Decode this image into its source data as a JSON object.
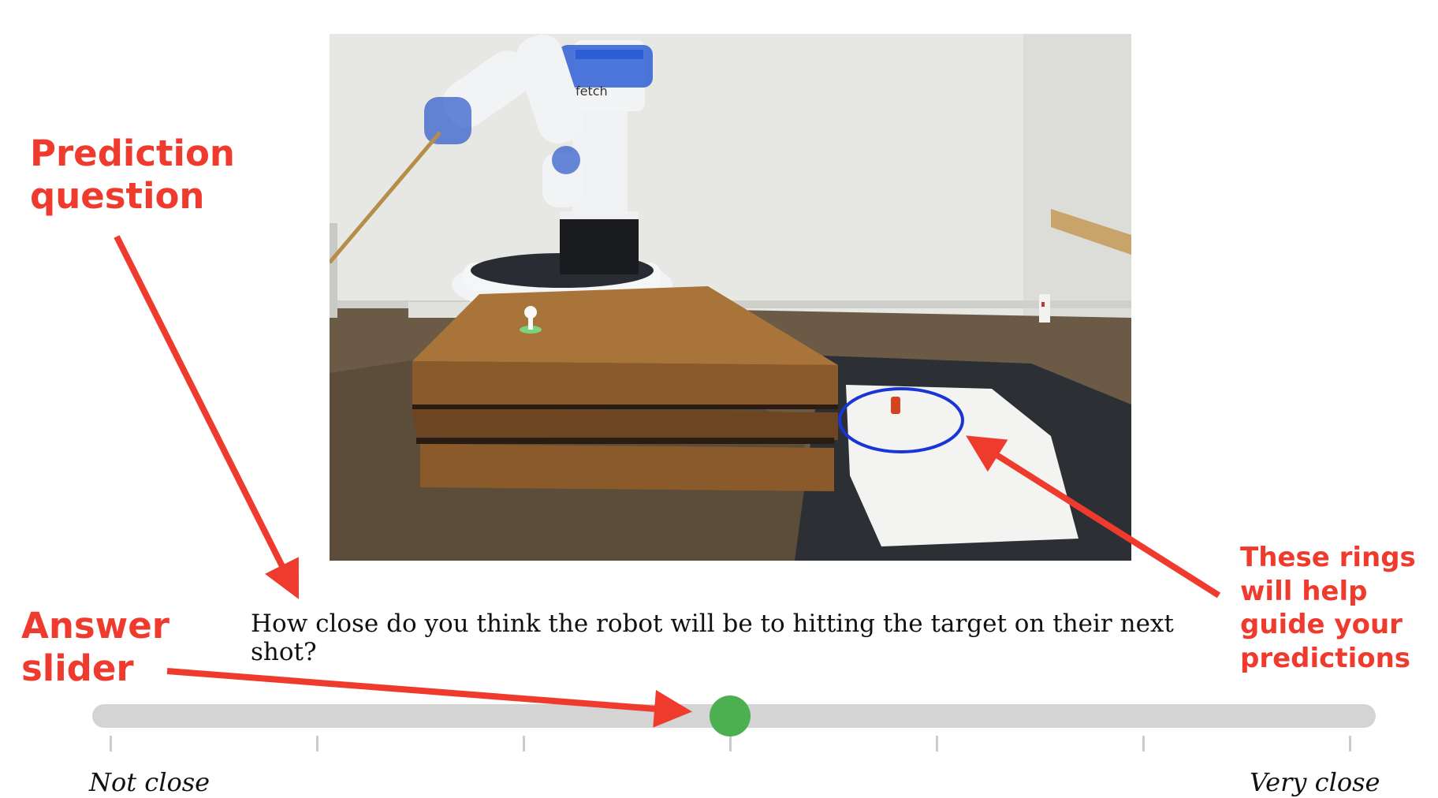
{
  "annotations": {
    "prediction_question": "Prediction\nquestion",
    "answer_slider": "Answer\nslider",
    "rings_hint": "These rings\nwill help\nguide your\npredictions"
  },
  "question": {
    "text": "How close do you think the robot will be to hitting the target on their next shot?"
  },
  "slider": {
    "min_label": "Not close",
    "max_label": "Very close",
    "value": 0.5,
    "tick_count": 7,
    "thumb_color": "#4caf50",
    "track_color": "#d4d4d4"
  },
  "scene": {
    "robot_label": "fetch"
  },
  "colors": {
    "annotation": "#ef3b2d",
    "ring": "#1a35d6"
  }
}
